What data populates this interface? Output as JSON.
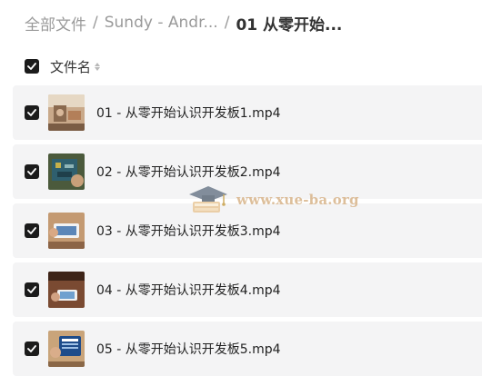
{
  "breadcrumb": {
    "items": [
      "全部文件",
      "Sundy - Andr...",
      "01 从零开始..."
    ],
    "separator": "/"
  },
  "header": {
    "name_label": "文件名",
    "checked": true
  },
  "files": [
    {
      "name": "01 - 从零开始认识开发板1.mp4",
      "checked": true,
      "thumb_icon": "video-thumbnail"
    },
    {
      "name": "02 - 从零开始认识开发板2.mp4",
      "checked": true,
      "thumb_icon": "video-thumbnail"
    },
    {
      "name": "03 - 从零开始认识开发板3.mp4",
      "checked": true,
      "thumb_icon": "video-thumbnail"
    },
    {
      "name": "04 - 从零开始认识开发板4.mp4",
      "checked": true,
      "thumb_icon": "video-thumbnail"
    },
    {
      "name": "05 - 从零开始认识开发板5.mp4",
      "checked": true,
      "thumb_icon": "video-thumbnail"
    }
  ],
  "watermark": {
    "text": "www.xue-ba.org"
  },
  "colors": {
    "checkbox": "#1b1b1b",
    "row_background": "#f4f4f5",
    "breadcrumb_muted": "#9a9a9a",
    "watermark": "#d8b48a"
  }
}
